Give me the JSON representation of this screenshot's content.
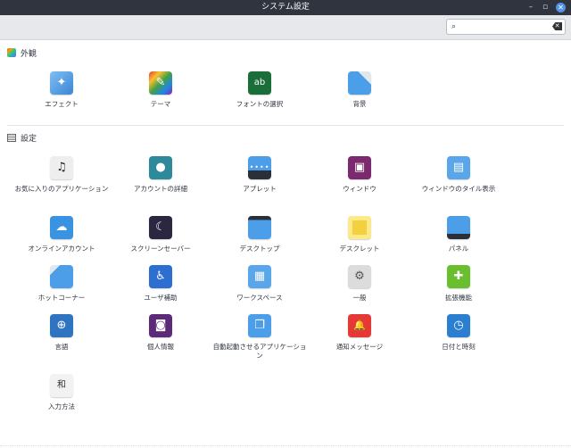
{
  "window": {
    "title": "システム設定",
    "minimize": "–",
    "maximize": "▫",
    "close": "✕"
  },
  "search": {
    "placeholder": "",
    "search_glyph": "⌕",
    "clear_glyph": "✕"
  },
  "sections": {
    "appearance": {
      "label": "外観"
    },
    "preferences": {
      "label": "設定"
    }
  },
  "items": {
    "effects": "エフェクト",
    "themes": "テーマ",
    "font": "フォントの選択",
    "background": "背景",
    "preferred_apps": "お気に入りのアプリケーション",
    "account": "アカウントの詳細",
    "applets": "アプレット",
    "windows": "ウィンドウ",
    "window_tiling": "ウィンドウのタイル表示",
    "online_accounts": "オンラインアカウント",
    "screensaver": "スクリーンセーバー",
    "desktop": "デスクトップ",
    "desklets": "デスクレット",
    "panel": "パネル",
    "hot_corners": "ホットコーナー",
    "accessibility": "ユーザ補助",
    "workspaces": "ワークスペース",
    "general": "一般",
    "extensions": "拡張機能",
    "languages": "言語",
    "privacy": "個人情報",
    "startup_apps": "自動起動させるアプリケーション",
    "notifications": "通知メッセージ",
    "date_time": "日付と時刻",
    "input_method": "入力方法"
  },
  "icon_glyphs": {
    "effects": "✦",
    "themes": "✎",
    "font": "ab",
    "background": "",
    "preferred_apps": "♫",
    "account": "●",
    "applets": "••••",
    "windows": "▣",
    "window_tiling": "▤",
    "online_accounts": "☁",
    "screensaver": "☾",
    "desktop": "",
    "desklets": "",
    "panel": "",
    "hot_corners": "",
    "accessibility": "♿",
    "workspaces": "▦",
    "general": "⚙",
    "extensions": "✚",
    "languages": "⊕",
    "privacy": "◙",
    "startup_apps": "❐",
    "notifications": "🔔",
    "date_time": "◷",
    "input_method": "和"
  },
  "colors": {
    "titlebar_bg": "#2f343f",
    "accent": "#5294e2",
    "toolbar_bg": "#e7e8eb"
  }
}
